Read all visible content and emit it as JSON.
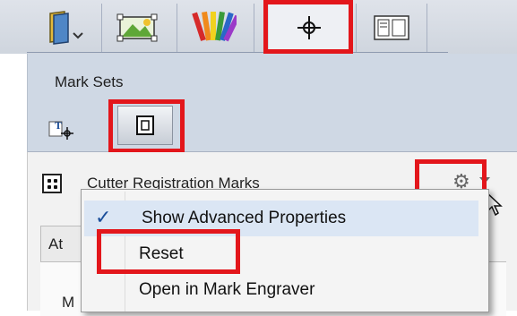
{
  "toolbar": {
    "icons": [
      "book-icon",
      "image-edit-icon",
      "color-palette-icon",
      "registration-mark-icon",
      "layout-icon"
    ],
    "active": "registration-mark-icon"
  },
  "marksets": {
    "title": "Mark Sets"
  },
  "panel": {
    "item_label": "Cutter Registration Marks",
    "tab_label": "At",
    "fragment": "M"
  },
  "menu": {
    "items": [
      {
        "label": "Show Advanced Properties",
        "checked": true
      },
      {
        "label": "Reset",
        "checked": false
      },
      {
        "label": "Open in Mark Engraver",
        "checked": false
      }
    ]
  },
  "colors": {
    "highlight": "#e3161b",
    "check": "#1a4e9a"
  }
}
